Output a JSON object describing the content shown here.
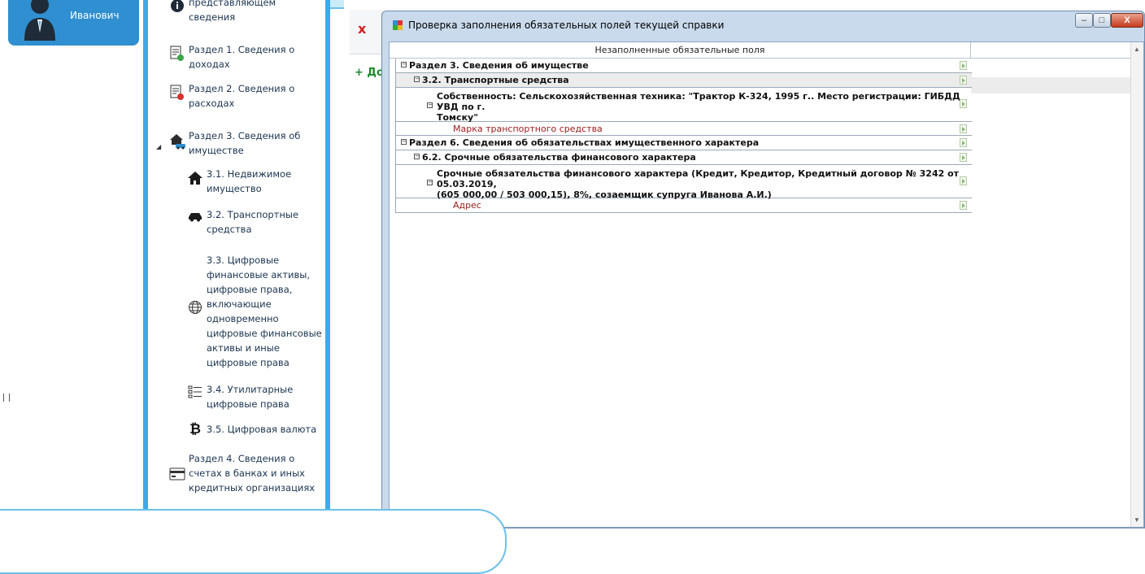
{
  "user": {
    "name": "Иванович"
  },
  "nav": {
    "items": [
      {
        "id": "predstav",
        "label": "представляющем\nсведения",
        "icon": "info-icon"
      },
      {
        "id": "razdel1",
        "label": "Раздел 1. Сведения о\nдоходах",
        "icon": "document-add-icon"
      },
      {
        "id": "razdel2",
        "label": "Раздел 2. Сведения о\nрасходах",
        "icon": "document-remove-icon"
      },
      {
        "id": "razdel3",
        "label": "Раздел 3. Сведения об\nимуществе",
        "icon": "house-car-icon"
      },
      {
        "id": "r31",
        "label": "3.1. Недвижимое\nимущество",
        "icon": "house-icon"
      },
      {
        "id": "r32",
        "label": "3.2. Транспортные\nсредства",
        "icon": "car-icon"
      },
      {
        "id": "r33",
        "label": "3.3. Цифровые\nфинансовые активы,\nцифровые права,\nвключающие\nодновременно\nцифровые финансовые\nактивы и иные\nцифровые права",
        "icon": "globe-icon"
      },
      {
        "id": "r34",
        "label": "3.4. Утилитарные\nцифровые права",
        "icon": "list-icon"
      },
      {
        "id": "r35",
        "label": "3.5. Цифровая валюта",
        "icon": "bitcoin-icon"
      },
      {
        "id": "razdel4",
        "label": "Раздел 4. Сведения о\nсчетах в банках и иных\nкредитных организациях",
        "icon": "card-icon"
      }
    ]
  },
  "main": {
    "close_glyph": "x",
    "add_label": "+ До"
  },
  "dialog": {
    "title": "Проверка заполнения обязательных полей текущей справки",
    "window_buttons": {
      "minimize": "–",
      "maximize": "□",
      "close": "X"
    },
    "column_header": "Незаполненные обязательные поля",
    "rows": [
      {
        "label": "Раздел 3. Сведения об имуществе",
        "level": 0,
        "bold": true,
        "toggle": "⊟"
      },
      {
        "label": "3.2. Транспортные средства",
        "level": 1,
        "bold": true,
        "toggle": "⊟"
      },
      {
        "label": "Собственность: Сельскохозяйственная техника: \"Трактор  К-324, 1995 г.. Место регистрации: ГИБДД УВД по г.",
        "label2": "Томску\"",
        "level": 2,
        "bold": true,
        "toggle": "⊟"
      },
      {
        "label": "Марка транспортного средства",
        "level": 3,
        "bold": false,
        "red": true
      },
      {
        "label": "Раздел 6. Сведения об обязательствах имущественного характера",
        "level": 0,
        "bold": true,
        "toggle": "⊟"
      },
      {
        "label": "6.2. Срочные обязательства финансового характера",
        "level": 1,
        "bold": true,
        "toggle": "⊟"
      },
      {
        "label": "Срочные обязательства финансового характера (Кредит, Кредитор, Кредитный договор № 3242 от 05.03.2019,",
        "label2": "(605 000,00 / 503 000,15), 8%, созаемщик супруга Иванова А.И.)",
        "level": 2,
        "bold": true,
        "toggle": "⊟"
      },
      {
        "label": "Адрес",
        "level": 3,
        "bold": false,
        "red": true
      }
    ]
  },
  "colors": {
    "accent": "#3fa9e8",
    "user_card": "#2f8fd0",
    "missing_field": "#9c1a1a",
    "add_green": "#1d8a2d"
  }
}
